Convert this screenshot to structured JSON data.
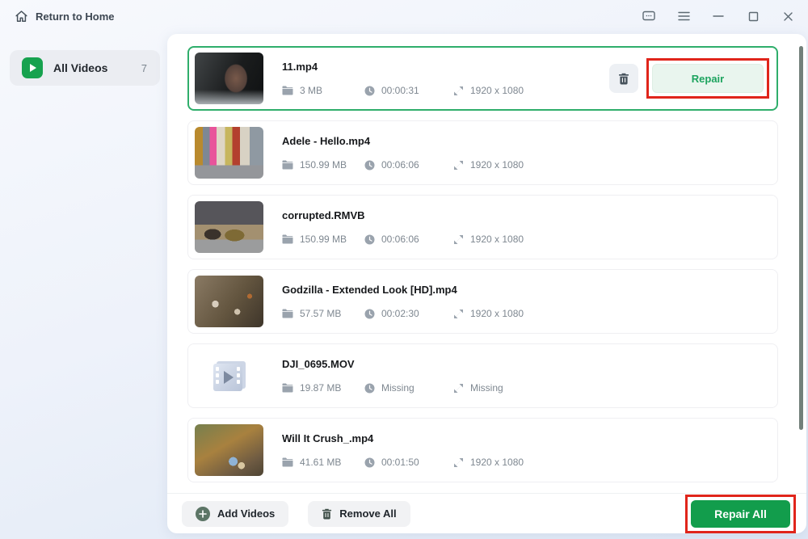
{
  "titlebar": {
    "return_home_label": "Return to Home"
  },
  "window_icons": [
    "feedback-icon",
    "menu-icon",
    "minimize-icon",
    "maximize-icon",
    "close-icon"
  ],
  "sidebar": {
    "items": [
      {
        "label": "All Videos",
        "count": "7"
      }
    ]
  },
  "list": {
    "items": [
      {
        "name": "11.mp4",
        "size": "3 MB",
        "duration": "00:00:31",
        "resolution": "1920 x 1080",
        "selected": true
      },
      {
        "name": "Adele - Hello.mp4",
        "size": "150.99 MB",
        "duration": "00:06:06",
        "resolution": "1920 x 1080",
        "selected": false
      },
      {
        "name": "corrupted.RMVB",
        "size": "150.99 MB",
        "duration": "00:06:06",
        "resolution": "1920 x 1080",
        "selected": false
      },
      {
        "name": "Godzilla - Extended Look [HD].mp4",
        "size": "57.57 MB",
        "duration": "00:02:30",
        "resolution": "1920 x 1080",
        "selected": false
      },
      {
        "name": "DJI_0695.MOV",
        "size": "19.87 MB",
        "duration": "Missing",
        "resolution": "Missing",
        "selected": false
      },
      {
        "name": "Will It Crush_.mp4",
        "size": "41.61 MB",
        "duration": "00:01:50",
        "resolution": "1920 x 1080",
        "selected": false
      }
    ]
  },
  "actions": {
    "repair": "Repair",
    "add_videos": "Add Videos",
    "remove_all": "Remove All",
    "repair_all": "Repair All"
  },
  "colors": {
    "accent_green": "#17a24f",
    "selected_border_green": "#2fae6b",
    "repair_all_green": "#129d4c",
    "annotation_red": "#e0251b"
  }
}
